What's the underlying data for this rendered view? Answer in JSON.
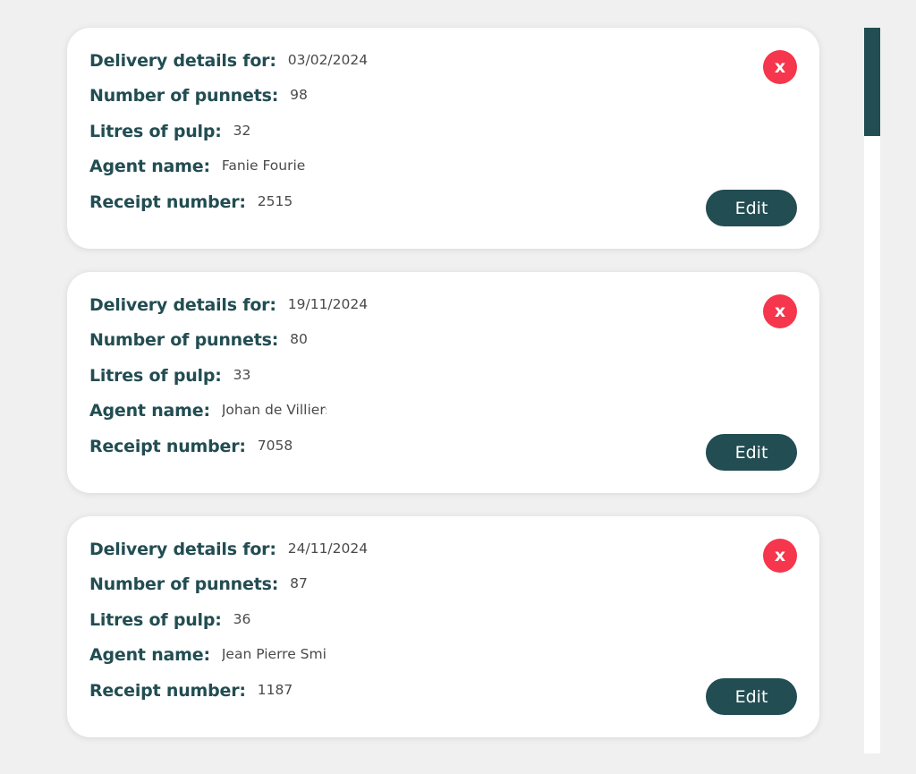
{
  "labels": {
    "delivery_details_for": "Delivery details for:",
    "number_of_punnets": "Number of punnets:",
    "litres_of_pulp": "Litres of pulp:",
    "agent_name": "Agent name:",
    "receipt_number": "Receipt number:"
  },
  "buttons": {
    "delete": "x",
    "edit": "Edit"
  },
  "deliveries": [
    {
      "date": "03/02/2024",
      "punnets": "98",
      "pulp_litres": "32",
      "agent_name": "Fanie Fourie",
      "receipt_number": "2515"
    },
    {
      "date": "19/11/2024",
      "punnets": "80",
      "pulp_litres": "33",
      "agent_name": "Johan de Villiers",
      "receipt_number": "7058"
    },
    {
      "date": "24/11/2024",
      "punnets": "87",
      "pulp_litres": "36",
      "agent_name": "Jean Pierre Smi",
      "receipt_number": "1187"
    }
  ],
  "colors": {
    "background": "#f0f0f0",
    "card": "#ffffff",
    "primary": "#224d52",
    "delete": "#f5364c",
    "value_text": "#4a4a4a"
  }
}
